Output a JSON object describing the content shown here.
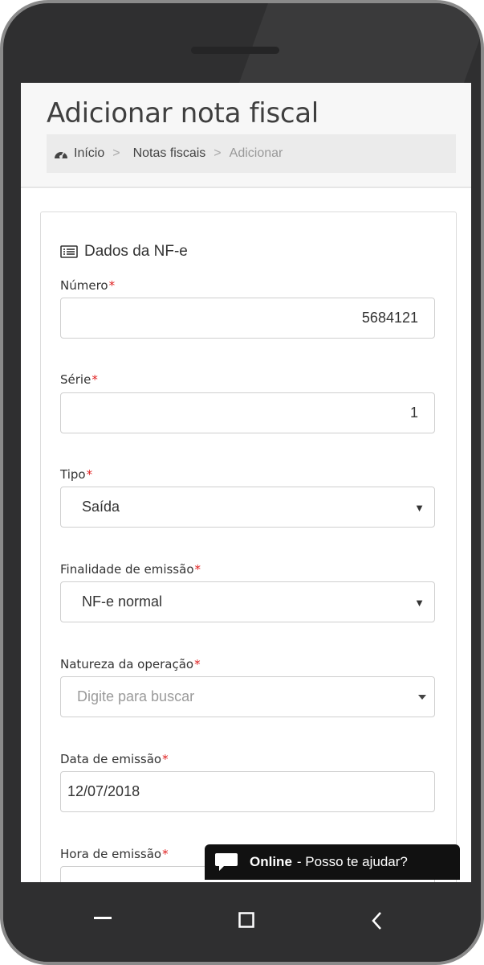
{
  "header": {
    "title": "Adicionar nota fiscal",
    "breadcrumb": [
      {
        "label": "Início"
      },
      {
        "label": "Notas fiscais"
      },
      {
        "label": "Adicionar"
      }
    ],
    "separator": ">"
  },
  "form": {
    "section_title": "Dados da NF-e",
    "required_mark": "*",
    "fields": {
      "numero": {
        "label": "Número",
        "value": "5684121"
      },
      "serie": {
        "label": "Série",
        "value": "1"
      },
      "tipo": {
        "label": "Tipo",
        "value": "Saída"
      },
      "finalidade": {
        "label": "Finalidade de emissão",
        "value": "NF-e normal"
      },
      "natureza": {
        "label": "Natureza da operação",
        "placeholder": "Digite para buscar"
      },
      "data": {
        "label": "Data de emissão",
        "value": "12/07/2018"
      },
      "hora": {
        "label": "Hora de emissão"
      }
    }
  },
  "chat": {
    "status": "Online",
    "message": "- Posso te ajudar?"
  },
  "icons": {
    "breadcrumb_home": "dashboard-icon",
    "section": "list-card-icon",
    "chat": "chat-bubble-icon"
  },
  "colors": {
    "required": "#e02020",
    "chat_bg": "#111111",
    "phone_body": "#2f2f30"
  }
}
